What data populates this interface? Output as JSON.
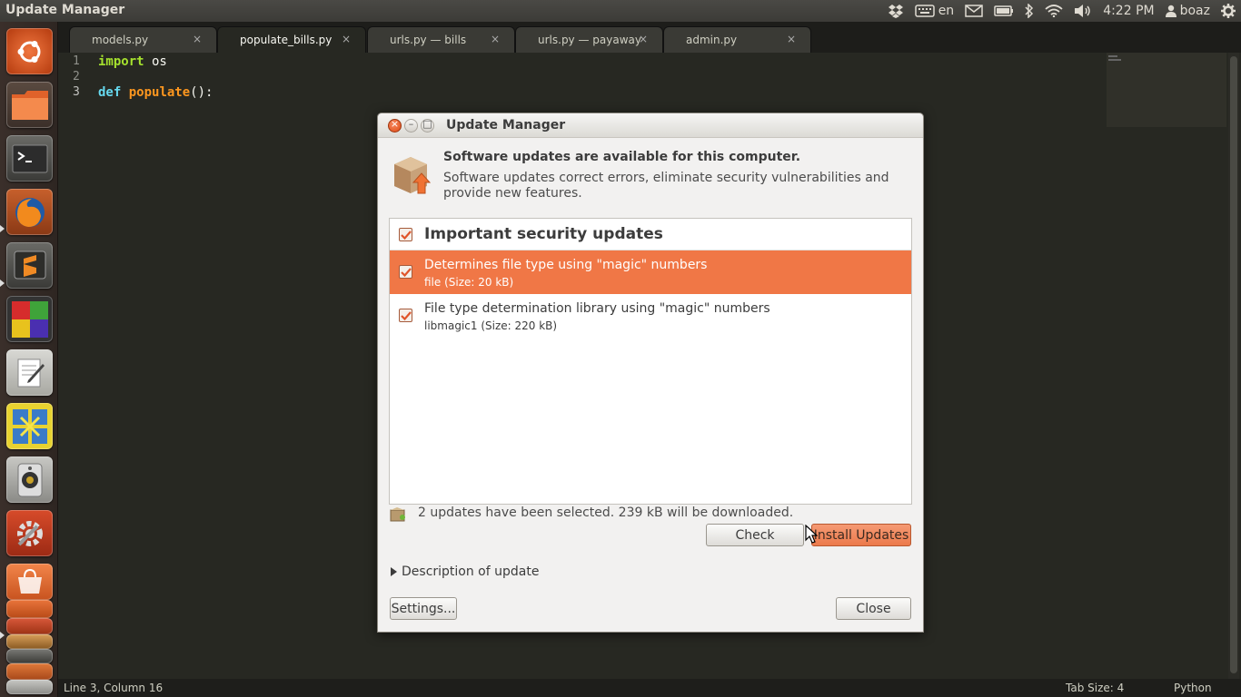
{
  "top_panel": {
    "app_title": "Update Manager",
    "keyboard_layout": "en",
    "clock": "4:22 PM",
    "user": "boaz",
    "icons": [
      "dropbox-icon",
      "keyboard-icon",
      "mail-icon",
      "battery-icon",
      "bluetooth-icon",
      "wifi-icon",
      "volume-icon",
      "user-icon",
      "settings-gear-icon"
    ]
  },
  "launcher": {
    "items": [
      "dash-home",
      "files",
      "terminal",
      "firefox",
      "sublime-text",
      "color-squares-app",
      "text-editor",
      "workspace-switcher",
      "speaker-app",
      "system-settings",
      "ubuntu-software-center",
      "stacked-apps"
    ]
  },
  "editor": {
    "tabs": [
      {
        "label": "models.py",
        "active": false
      },
      {
        "label": "populate_bills.py",
        "active": true
      },
      {
        "label": "urls.py — bills",
        "active": false
      },
      {
        "label": "urls.py — payaway",
        "active": false
      },
      {
        "label": "admin.py",
        "active": false
      }
    ],
    "tab_close_glyph": "×",
    "lines": [
      {
        "num": "1",
        "kw": "import",
        "rest": " os"
      },
      {
        "num": "2",
        "kw": "",
        "rest": ""
      },
      {
        "num": "3",
        "kw": "def",
        "fn": "populate",
        "rest": "():"
      }
    ],
    "status": {
      "position": "Line 3, Column 16",
      "tab_size": "Tab Size: 4",
      "syntax": "Python"
    }
  },
  "dialog": {
    "title": "Update Manager",
    "header_title": "Software updates are available for this computer.",
    "header_desc": "Software updates correct errors, eliminate security vulnerabilities and provide new features.",
    "group": {
      "label": "Important security updates",
      "checked": true
    },
    "items": [
      {
        "name": "Determines file type using \"magic\" numbers",
        "sub": "file (Size: 20 kB)",
        "checked": true,
        "selected": true
      },
      {
        "name": "File type determination library using \"magic\" numbers",
        "sub": "libmagic1 (Size: 220 kB)",
        "checked": true,
        "selected": false
      }
    ],
    "summary": "2 updates have been selected. 239 kB will be downloaded.",
    "buttons": {
      "check": "Check",
      "install": "Install Updates",
      "settings": "Settings...",
      "close": "Close"
    },
    "expander": "Description of update"
  },
  "colors": {
    "accent_orange": "#f07746",
    "editor_bg": "#272822",
    "panel_bg": "#3c3b37"
  }
}
